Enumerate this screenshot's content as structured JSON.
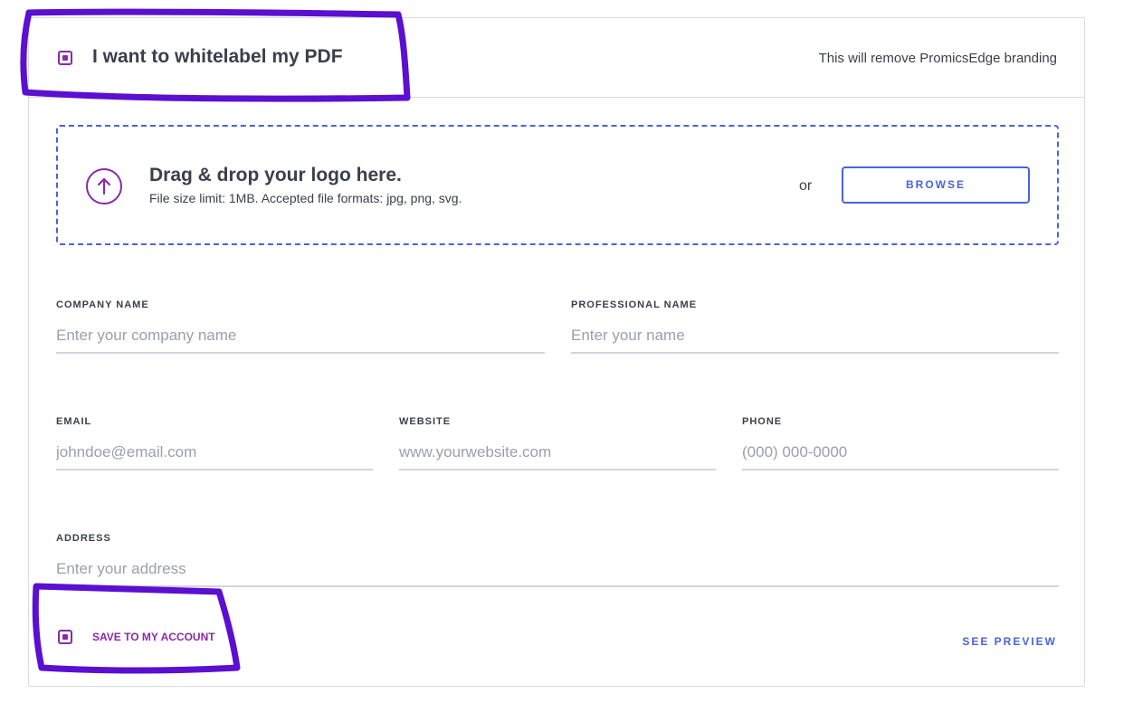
{
  "header": {
    "title": "I want to whitelabel my PDF",
    "note": "This will remove PromicsEdge branding"
  },
  "dropzone": {
    "title": "Drag & drop your logo here.",
    "subtitle": "File size limit: 1MB. Accepted file formats: jpg, png, svg.",
    "or_text": "or",
    "browse_label": "BROWSE"
  },
  "fields": {
    "company_name": {
      "label": "COMPANY NAME",
      "placeholder": "Enter your company name"
    },
    "professional_name": {
      "label": "PROFESSIONAL NAME",
      "placeholder": "Enter your name"
    },
    "email": {
      "label": "EMAIL",
      "placeholder": "johndoe@email.com"
    },
    "website": {
      "label": "WEBSITE",
      "placeholder": "www.yourwebsite.com"
    },
    "phone": {
      "label": "PHONE",
      "placeholder": "(000) 000-0000"
    },
    "address": {
      "label": "ADDRESS",
      "placeholder": "Enter your address"
    }
  },
  "footer": {
    "save_label": "SAVE TO MY ACCOUNT",
    "preview_label": "SEE PREVIEW"
  },
  "colors": {
    "accent_purple": "#8a2aa8",
    "accent_blue": "#4a63d8",
    "annotation_marker": "#5b0fd1"
  },
  "icons": {
    "upload": "arrow-up-circle-icon"
  }
}
